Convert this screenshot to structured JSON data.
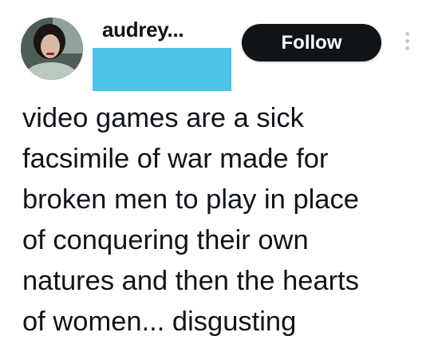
{
  "tweet": {
    "author_name": "audrey...",
    "follow_label": "Follow",
    "redaction_color": "#4bc4e8",
    "lines": [
      "video games are a sick",
      "facsimile of war made for",
      "broken men to play in place",
      "of conquering their own",
      "natures and then the hearts",
      "of women... disgusting"
    ]
  },
  "icons": {
    "more": "more-vertical-icon"
  }
}
